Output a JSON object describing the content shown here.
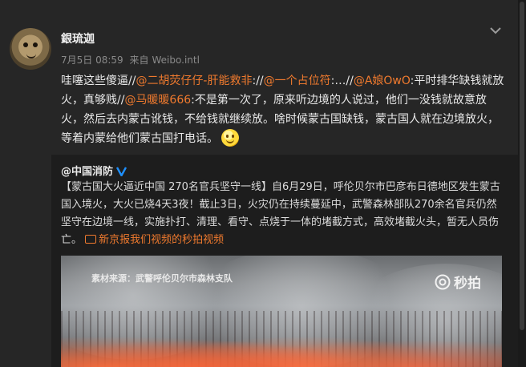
{
  "post": {
    "username": "銀琉迦",
    "date": "7月5日 08:59",
    "source_prefix": "来自",
    "source": "Weibo.intl",
    "text_parts": [
      {
        "t": "哇噻这些傻逼//",
        "m": false
      },
      {
        "t": "@二胡荧仔仔-肝能救非",
        "m": true
      },
      {
        "t": "://",
        "m": false
      },
      {
        "t": "@一个占位符",
        "m": true
      },
      {
        "t": ":…//",
        "m": false
      },
      {
        "t": "@A娘OwO",
        "m": true
      },
      {
        "t": ":平时排华缺钱就放火，真够贱//",
        "m": false
      },
      {
        "t": "@马暖暖666",
        "m": true
      },
      {
        "t": ":不是第一次了，原来听边境的人说过，他们一没钱就故意放火，然后去内蒙古讹钱，不给钱就继续放。啥时候蒙古国缺钱，蒙古国人就在边境放火，等着内蒙给他们蒙古国打电话。",
        "m": false
      }
    ]
  },
  "repost": {
    "author": "@中国消防",
    "text": "【蒙古国大火逼近中国 270名官兵坚守一线】自6月29日，呼伦贝尔市巴彦布日德地区发生蒙古国入境火，大火已烧4天3夜！截止3日，火灾仍在持续蔓延中，武警森林部队270余名官兵仍然坚守在边境一线，实施扑打、清理、看守、点烧于一体的堵截方式，高效堵截火头，暂无人员伤亡。",
    "video_link": "新京报我们视频的秒拍视频",
    "media_source": "素材来源：武警呼伦贝尔市森林支队",
    "watermark": "秒拍"
  },
  "colors": {
    "mention": "#f07a2e",
    "verified": "#1e90ff"
  }
}
